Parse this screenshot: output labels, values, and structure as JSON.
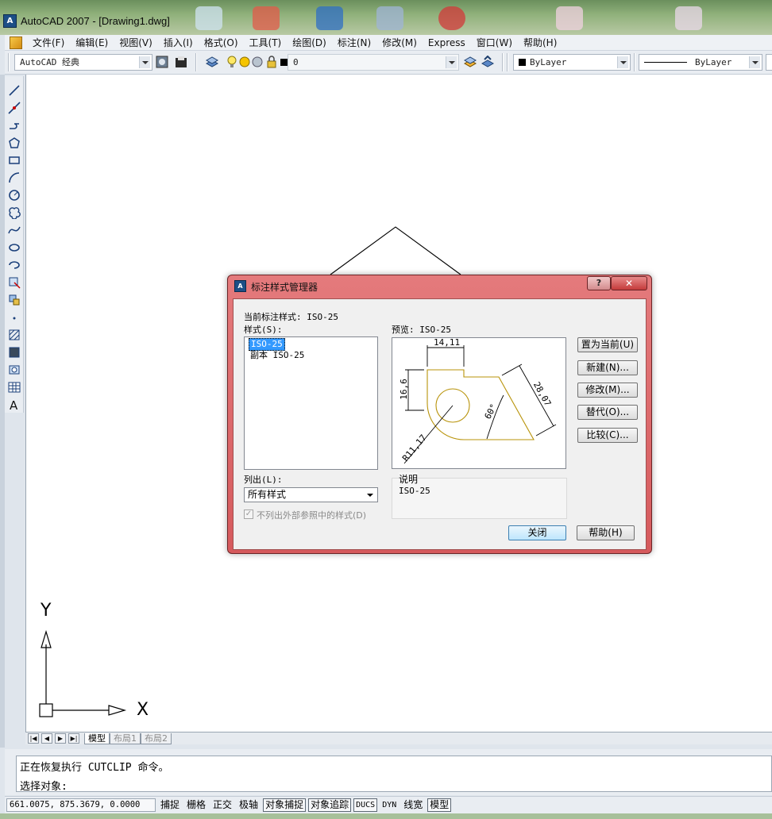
{
  "window": {
    "title": "AutoCAD 2007 - [Drawing1.dwg]",
    "app_icon_text": "A"
  },
  "menubar": {
    "items": [
      "文件(F)",
      "编辑(E)",
      "视图(V)",
      "插入(I)",
      "格式(O)",
      "工具(T)",
      "绘图(D)",
      "标注(N)",
      "修改(M)",
      "Express",
      "窗口(W)",
      "帮助(H)"
    ]
  },
  "toolbar": {
    "workspace": "AutoCAD 经典",
    "layer": "0",
    "color": "ByLayer",
    "linetype": "ByLayer"
  },
  "ucs": {
    "y_label": "Y",
    "x_label": "X"
  },
  "layout_tabs": {
    "model": "模型",
    "layout1": "布局1",
    "layout2": "布局2"
  },
  "command_line": {
    "line1": "正在恢复执行 CUTCLIP 命令。",
    "line2": "选择对象:"
  },
  "statusbar": {
    "coords": "661.0075, 875.3679, 0.0000",
    "buttons": [
      "捕捉",
      "栅格",
      "正交",
      "极轴",
      "对象捕捉",
      "对象追踪",
      "DUCS",
      "DYN",
      "线宽",
      "模型"
    ]
  },
  "dialog": {
    "title": "标注样式管理器",
    "help_glyph": "?",
    "close_glyph": "✕",
    "current_style_label": "当前标注样式: ISO-25",
    "styles_label": "样式(S):",
    "styles": [
      "ISO-25",
      "副本 ISO-25"
    ],
    "preview_label": "预览: ISO-25",
    "list_label": "列出(L):",
    "list_value": "所有样式",
    "xref_checkbox_label": "不列出外部参照中的样式(D)",
    "description_label": "说明",
    "description_value": "ISO-25",
    "buttons": {
      "set_current": "置为当前(U)",
      "new": "新建(N)...",
      "modify": "修改(M)...",
      "override": "替代(O)...",
      "compare": "比较(C)...",
      "close": "关闭",
      "help": "帮助(H)"
    },
    "preview_dims": {
      "top": "14,11",
      "left": "16,6",
      "diag": "28,07",
      "angle": "60°",
      "radius": "R11,17"
    }
  },
  "colors": {
    "dialog_frame": "#d65a5d",
    "preview_shape": "#b8930a",
    "selection": "#3399ff"
  }
}
